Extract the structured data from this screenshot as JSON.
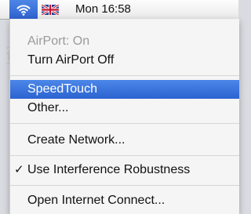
{
  "menubar": {
    "wifi_icon": "wifi-icon",
    "flag_icon": "uk-flag-icon",
    "clock": "Mon 16:58"
  },
  "menu": {
    "status": "AirPort: On",
    "turn_off": "Turn AirPort Off",
    "networks": [
      {
        "label": "SpeedTouch",
        "selected": true
      },
      {
        "label": "Other...",
        "selected": false
      }
    ],
    "create_network": "Create Network...",
    "interference": {
      "label": "Use Interference Robustness",
      "checked": true,
      "check_glyph": "✓"
    },
    "open_connect": "Open Internet Connect..."
  },
  "colors": {
    "highlight": "#3a72dc",
    "disabled_text": "#9a9a9a"
  }
}
